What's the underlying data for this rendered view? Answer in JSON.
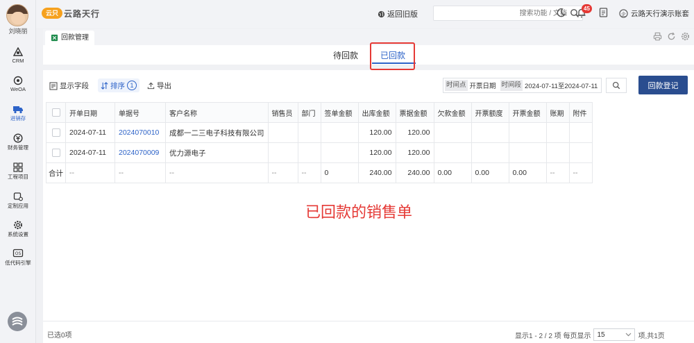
{
  "user": {
    "name": "刘晓丽"
  },
  "sidebar": {
    "items": [
      {
        "label": "CRM"
      },
      {
        "label": "WeOA"
      },
      {
        "label": "进销存"
      },
      {
        "label": "财务管理"
      },
      {
        "label": "工程项目"
      },
      {
        "label": "定制应用"
      },
      {
        "label": "系统设置"
      },
      {
        "label": "低代码引擎"
      }
    ]
  },
  "topbar": {
    "logo_mark": "云只",
    "brand": "云路天行",
    "back_old": "返回旧版",
    "search_placeholder": "搜索功能 / 文档",
    "notification_count": "45",
    "account": "云路天行演示账套"
  },
  "page_tab": {
    "label": "回款管理"
  },
  "subtabs": [
    {
      "label": "待回款"
    },
    {
      "label": "已回款"
    }
  ],
  "toolbar": {
    "show_fields": "显示字段",
    "sort": "排序",
    "sort_count": "1",
    "export": "导出",
    "tag_timepoint": "时间点",
    "field_date": "开票日期",
    "tag_period": "时间段",
    "date_range": "2024-07-11至2024-07-11",
    "register_button": "回款登记"
  },
  "table": {
    "headers": [
      "开单日期",
      "单据号",
      "客户名称",
      "销售员",
      "部门",
      "签单金额",
      "出库金额",
      "票据金额",
      "欠款金额",
      "开票额度",
      "开票金额",
      "账期",
      "附件"
    ],
    "rows": [
      [
        "2024-07-11",
        "2024070010",
        "成都一二三电子科技有限公司",
        "",
        "",
        "",
        "120.00",
        "120.00",
        "",
        "",
        "",
        "",
        ""
      ],
      [
        "2024-07-11",
        "2024070009",
        "优力源电子",
        "",
        "",
        "",
        "120.00",
        "120.00",
        "",
        "",
        "",
        "",
        ""
      ]
    ],
    "total_label": "合计",
    "total_row": [
      "--",
      "--",
      "--",
      "--",
      "--",
      "0",
      "240.00",
      "240.00",
      "0.00",
      "0.00",
      "0.00",
      "--",
      "--"
    ]
  },
  "annotation": "已回款的销售单",
  "footer": {
    "selected": "已选0项",
    "page_summary": "显示1 - 2 / 2 项  每页显示",
    "page_size": "15",
    "page_suffix": "项,共1页"
  }
}
